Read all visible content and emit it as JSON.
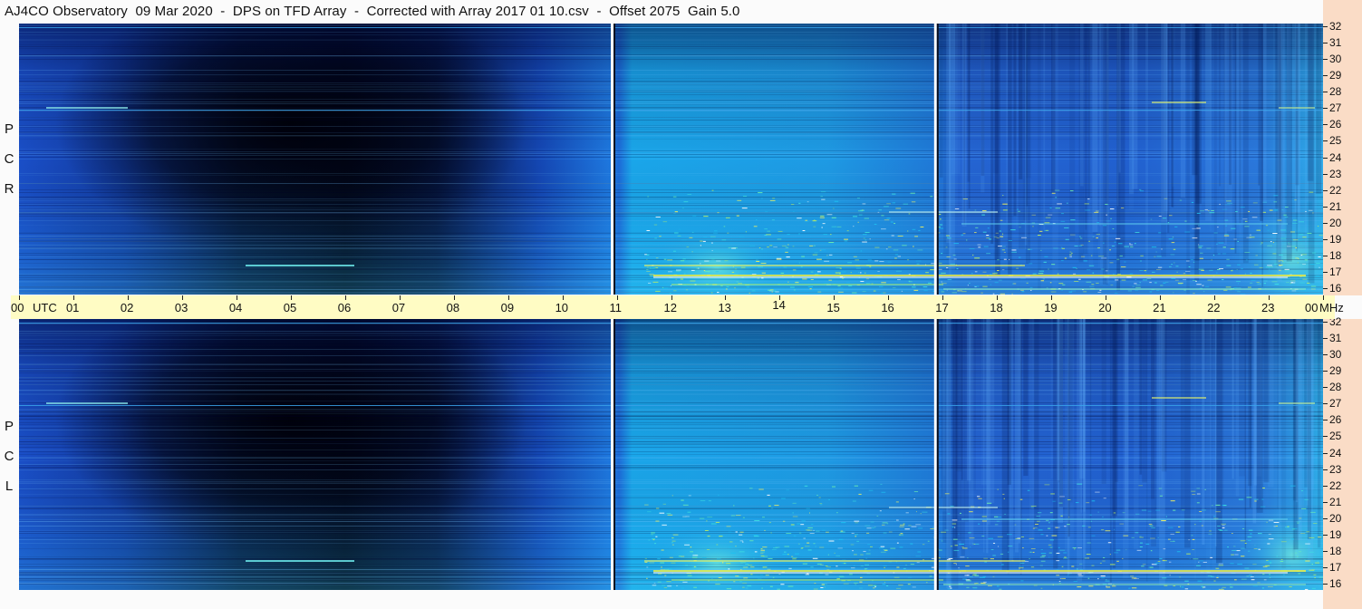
{
  "title": "AJ4CO Observatory  09 Mar 2020  -  DPS on TFD Array  -  Corrected with Array 2017 01 10.csv  -  Offset 2075  Gain 5.0",
  "panels": [
    {
      "name": "rcp",
      "letters": [
        "R",
        "C",
        "P"
      ]
    },
    {
      "name": "lcp",
      "letters": [
        "L",
        "C",
        "P"
      ]
    }
  ],
  "time_axis": {
    "labels": [
      "00",
      "UTC",
      "01",
      "02",
      "03",
      "04",
      "05",
      "06",
      "07",
      "08",
      "09",
      "10",
      "11",
      "12",
      "13",
      "14",
      "15",
      "16",
      "17",
      "18",
      "19",
      "20",
      "21",
      "22",
      "23",
      "00",
      "MHz"
    ]
  },
  "freq_axis": {
    "labels": [
      "32",
      "31",
      "30",
      "29",
      "28",
      "27",
      "26",
      "25",
      "24",
      "23",
      "22",
      "21",
      "20",
      "19",
      "18",
      "17",
      "16"
    ]
  },
  "colors": {
    "background": "#2468e0",
    "dark": "#000820",
    "bright": "#23c6f0",
    "hot": "#f4f040",
    "freq_axis_bg": "#fadcc6",
    "time_axis_bg": "#fffcc4"
  },
  "chart_data": {
    "type": "heatmap",
    "title": "AJ4CO Observatory  09 Mar 2020  -  DPS on TFD Array  -  Corrected with Array 2017 01 10.csv  -  Offset 2075  Gain 5.0",
    "x": {
      "label": "UTC",
      "range": [
        "00",
        "00"
      ],
      "ticks": [
        "01",
        "02",
        "03",
        "04",
        "05",
        "06",
        "07",
        "08",
        "09",
        "10",
        "11",
        "12",
        "13",
        "14",
        "15",
        "16",
        "17",
        "18",
        "19",
        "20",
        "21",
        "22",
        "23"
      ]
    },
    "y": {
      "label": "MHz",
      "range": [
        16,
        32
      ],
      "ticks": [
        16,
        17,
        18,
        19,
        20,
        21,
        22,
        23,
        24,
        25,
        26,
        27,
        28,
        29,
        30,
        31,
        32
      ]
    },
    "series": [
      {
        "name": "RCP",
        "description_bands": "dark night 00-09 UTC, bright daytime 11-23 UTC, strongest 16-22 MHz"
      },
      {
        "name": "LCP",
        "description_bands": "dark night 00-09 UTC, bright daytime 11-23 UTC, strongest 16-22 MHz"
      }
    ],
    "vertical_markers_utc": [
      10.9,
      16.85
    ]
  }
}
